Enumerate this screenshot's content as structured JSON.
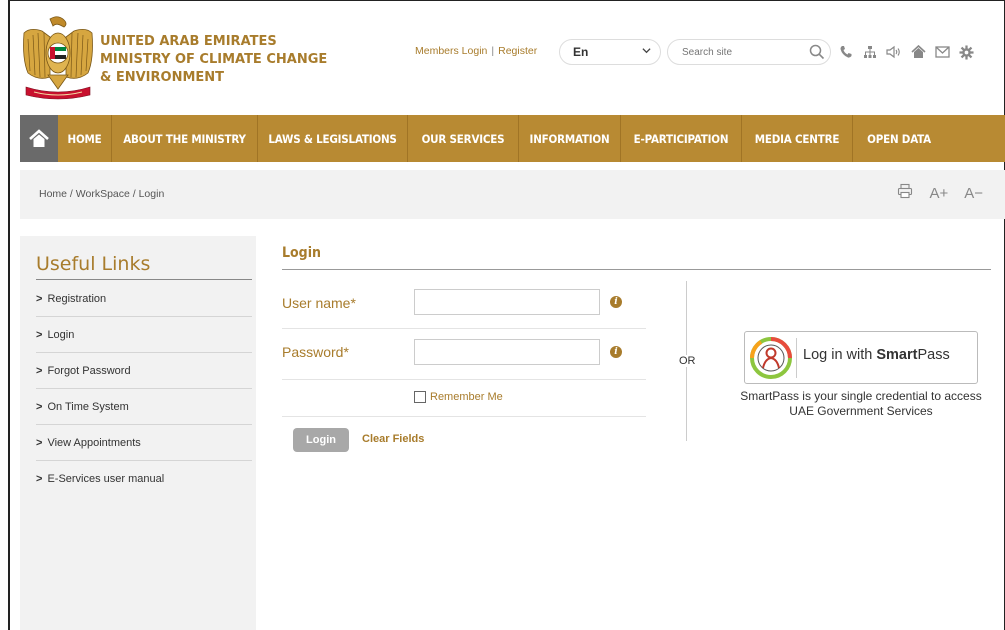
{
  "header": {
    "ministry_line1": "UNITED ARAB EMIRATES",
    "ministry_line2": "MINISTRY OF CLIMATE CHANGE",
    "ministry_line3": "& ENVIRONMENT",
    "members_login": "Members Login",
    "register": "Register",
    "language": "En",
    "search_placeholder": "Search site",
    "tools": [
      "phone-icon",
      "sitemap-icon",
      "audio-icon",
      "home-icon",
      "mail-icon",
      "gear-icon"
    ]
  },
  "nav": {
    "items": [
      "HOME",
      "ABOUT THE MINISTRY",
      "LAWS & LEGISLATIONS",
      "OUR SERVICES",
      "INFORMATION",
      "E-PARTICIPATION",
      "MEDIA CENTRE",
      "OPEN DATA"
    ]
  },
  "breadcrumb": {
    "text": "Home / WorkSpace / Login",
    "font_increase": "A+",
    "font_decrease": "A−"
  },
  "sidebar": {
    "title": "Useful Links",
    "items": [
      "Registration",
      "Login",
      "Forgot Password",
      "On Time System",
      "View Appointments",
      "E-Services user manual"
    ]
  },
  "main": {
    "title": "Login",
    "username_label": "User name*",
    "password_label": "Password*",
    "remember_label": "Remember Me",
    "login_button": "Login",
    "clear_button": "Clear Fields",
    "or_text": "OR",
    "smartpass_prefix": "Log in with ",
    "smartpass_bold": "Smart",
    "smartpass_suffix": "Pass",
    "smartpass_desc": "SmartPass is your single credential to access UAE Government Services"
  },
  "colors": {
    "gold": "#a87c2c",
    "nav_bg": "#b88a33",
    "home_bg": "#6a6a6a",
    "panel_bg": "#f2f2f2"
  }
}
